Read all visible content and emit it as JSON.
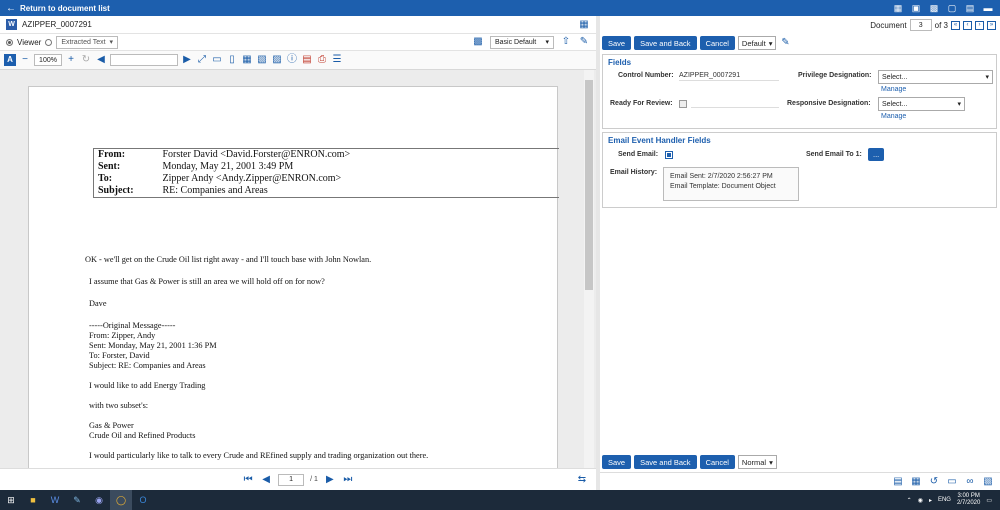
{
  "topbar": {
    "back_label": "Return to document list"
  },
  "left": {
    "doc_name": "AZIPPER_0007291",
    "viewer_label": "Viewer",
    "extracted_text_label": "Extracted Text",
    "layout_label": "Basic Default",
    "zoom": "100%",
    "email": {
      "from_label": "From:",
      "from_value": "Forster David <David.Forster@ENRON.com>",
      "sent_label": "Sent:",
      "sent_value": "Monday, May 21, 2001 3:49 PM",
      "to_label": "To:",
      "to_value": "Zipper Andy <Andy.Zipper@ENRON.com>",
      "subject_label": "Subject:",
      "subject_value": "RE: Companies and Areas"
    },
    "body_lines": [
      "OK - we'll get on the Crude Oil list right away - and I'll touch base with John Nowlan.",
      "I assume that Gas & Power is still an area we will hold off on for now?",
      "Dave",
      " -----Original Message-----",
      "From:   Zipper, Andy",
      "Sent:   Monday, May 21, 2001 1:36 PM",
      "To:     Forster, David",
      "Subject:        RE: Companies and Areas",
      "I would like to add Energy Trading",
      "with two subset's:",
      "Gas & Power",
      "Crude Oil and Refined Products",
      "I would particularly like to talk to every Crude and REfined supply and trading organization out there."
    ],
    "pager": {
      "page": "1",
      "total": "/ 1"
    }
  },
  "right": {
    "document_label": "Document",
    "document_number": "3",
    "document_total": "of 3",
    "save": "Save",
    "save_back": "Save and Back",
    "cancel": "Cancel",
    "layout_top": "Default",
    "layout_bottom": "Normal",
    "fields_title": "Fields",
    "control_number_label": "Control Number:",
    "control_number_value": "AZIPPER_0007291",
    "privilege_label": "Privilege Designation:",
    "privilege_value": "Select...",
    "manage": "Manage",
    "ready_label": "Ready For Review:",
    "responsive_label": "Responsive Designation:",
    "responsive_value": "Select...",
    "email_title": "Email Event Handler Fields",
    "send_email_label": "Send Email:",
    "send_email_to_label": "Send Email To 1:",
    "send_email_to_btn": "...",
    "email_history_label": "Email History:",
    "email_history_lines": [
      "Email Sent: 2/7/2020 2:56:27 PM",
      "Email Template: Document Object"
    ]
  },
  "taskbar": {
    "lang": "ENG",
    "time": "3:00 PM",
    "date": "2/7/2020"
  }
}
